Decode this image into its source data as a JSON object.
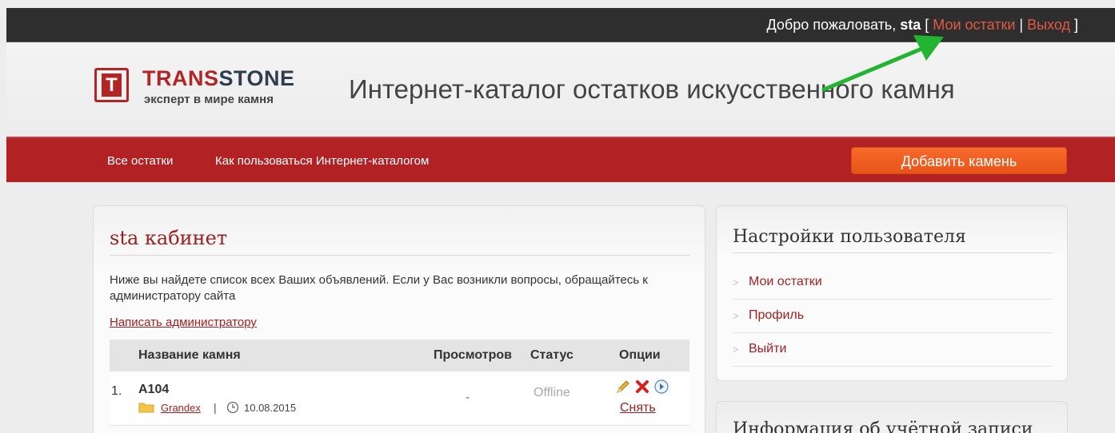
{
  "topbar": {
    "welcome_prefix": "Добро пожаловать,",
    "username": "sta",
    "bracket_open": "[",
    "my_stones": "Мои остатки",
    "divider": "|",
    "logout": "Выход",
    "bracket_close": "]"
  },
  "logo": {
    "letter": "T",
    "name_part1": "TRANS",
    "name_part2": "STONE",
    "tagline": "эксперт в мире камня"
  },
  "header": {
    "title": "Интернет-каталог остатков искусственного камня"
  },
  "nav": {
    "items": [
      "Все остатки",
      "Как пользоваться Интернет-каталогом"
    ],
    "add_button": "Добавить камень"
  },
  "cabinet": {
    "title": "sta кабинет",
    "description": "Ниже вы найдете список всех Ваших объявлений. Если у Вас возникли вопросы, обращайтесь к администратору сайта",
    "write_admin": "Написать администратору",
    "columns": [
      "Название камня",
      "Просмотров",
      "Статус",
      "Опции"
    ],
    "rows": [
      {
        "num": "1.",
        "name": "A104",
        "category": "Grandex",
        "separator": "|",
        "date": "10.08.2015",
        "views": "-",
        "status": "Offline",
        "remove": "Снять"
      }
    ]
  },
  "sidebar": {
    "title": "Настройки пользователя",
    "items": [
      "Мои остатки",
      "Профиль",
      "Выйти"
    ],
    "info_title": "Информация об учётной записи"
  },
  "colors": {
    "brand_red": "#b22224",
    "accent_orange": "#f76a2b",
    "link_red": "#a42020",
    "arrow_green": "#22b532"
  }
}
